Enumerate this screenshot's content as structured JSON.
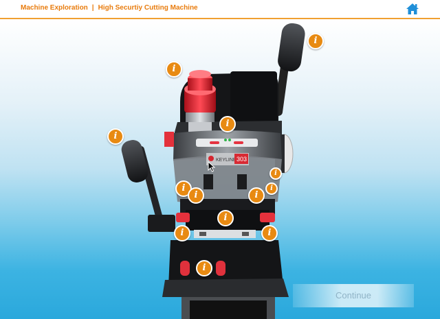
{
  "header": {
    "breadcrumb_section": "Machine Exploration",
    "breadcrumb_separator": "|",
    "breadcrumb_page": "High Securtiy Cutting Machine",
    "home_icon": "home-icon"
  },
  "hotspots": {
    "icon_glyph": "i",
    "color": "#e88a12"
  },
  "machine": {
    "brand_label": "KEYLINE",
    "model_label": "303"
  },
  "footer": {
    "continue_label": "Continue"
  }
}
